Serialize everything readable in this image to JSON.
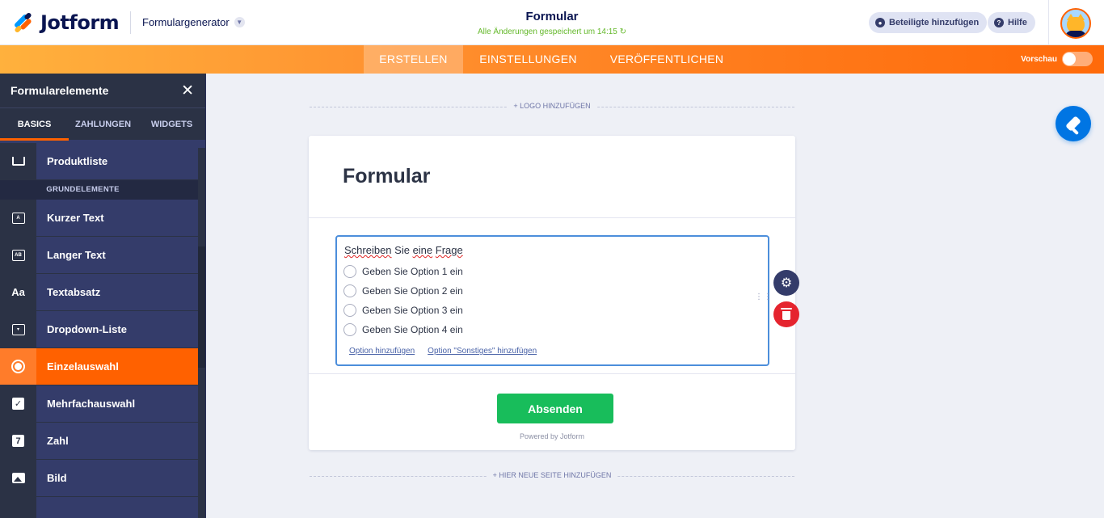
{
  "header": {
    "brand": "Jotform",
    "generator_label": "Formulargenerator",
    "form_title": "Formular",
    "saved_status": "Alle Änderungen gespeichert um 14:15",
    "invite_label": "Beteiligte hinzufügen",
    "help_label": "Hilfe"
  },
  "nav": {
    "tabs": [
      {
        "label": "ERSTELLEN",
        "active": true
      },
      {
        "label": "EINSTELLUNGEN",
        "active": false
      },
      {
        "label": "VERÖFFENTLICHEN",
        "active": false
      }
    ],
    "preview_label": "Vorschau"
  },
  "sidebar": {
    "title": "Formularelemente",
    "tabs": [
      {
        "label": "BASICS",
        "active": true
      },
      {
        "label": "ZAHLUNGEN",
        "active": false
      },
      {
        "label": "WIDGETS",
        "active": false
      }
    ],
    "first_item": {
      "label": "Produktliste",
      "icon": "cart-icon"
    },
    "section_heading": "GRUNDELEMENTE",
    "items": [
      {
        "label": "Kurzer Text",
        "icon": "short-text-icon"
      },
      {
        "label": "Langer Text",
        "icon": "long-text-icon"
      },
      {
        "label": "Textabsatz",
        "icon": "paragraph-icon",
        "glyph": "Aa"
      },
      {
        "label": "Dropdown-Liste",
        "icon": "dropdown-icon"
      },
      {
        "label": "Einzelauswahl",
        "icon": "radio-icon",
        "active": true
      },
      {
        "label": "Mehrfachauswahl",
        "icon": "checkbox-icon"
      },
      {
        "label": "Zahl",
        "icon": "number-icon",
        "glyph": "7"
      },
      {
        "label": "Bild",
        "icon": "image-icon"
      }
    ]
  },
  "canvas": {
    "add_logo_label": "+ LOGO HINZUFÜGEN",
    "form_heading": "Formular",
    "question": {
      "text_part1": "Schreiben",
      "text_part2": " Sie ",
      "text_part3": "eine",
      "text_part4": " ",
      "text_part5": "Frage",
      "options": [
        "Geben Sie Option 1 ein",
        "Geben Sie Option 2 ein",
        "Geben Sie Option 3 ein",
        "Geben Sie Option 4 ein"
      ],
      "add_option_label": "Option hinzufügen",
      "add_other_label": "Option \"Sonstiges\" hinzufügen"
    },
    "submit_label": "Absenden",
    "powered_by": "Powered by Jotform",
    "add_page_label": "+ HIER NEUE SEITE HINZUFÜGEN"
  },
  "colors": {
    "accent_orange": "#ff6100",
    "submit_green": "#18bd5b",
    "saved_green": "#64b82a",
    "sidebar_bg": "#343c6a",
    "delete_red": "#e5242e",
    "focus_blue": "#4c8edb",
    "design_blue": "#0075e3"
  }
}
